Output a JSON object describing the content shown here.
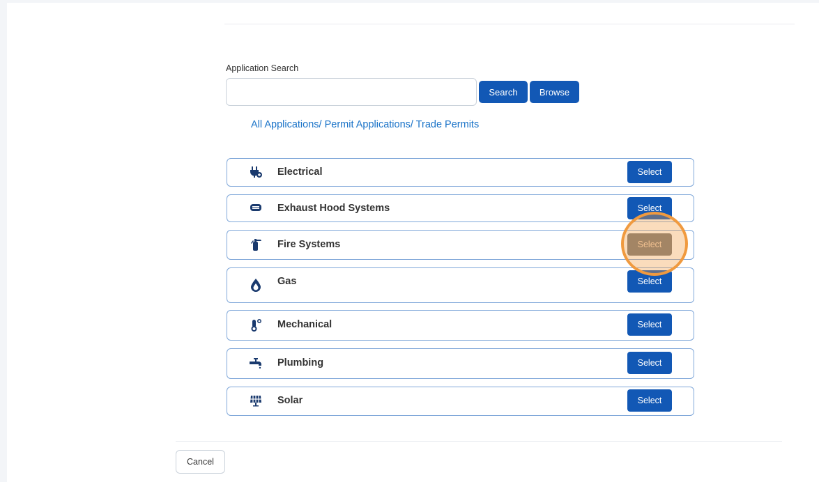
{
  "search": {
    "label": "Application Search",
    "value": "",
    "placeholder": "",
    "search_button": "Search",
    "browse_button": "Browse"
  },
  "breadcrumb": "All Applications/ Permit Applications/ Trade Permits",
  "categories": [
    {
      "label": "Electrical",
      "icon": "plug-icon",
      "button": "Select"
    },
    {
      "label": "Exhaust Hood Systems",
      "icon": "hood-vent-icon",
      "button": "Select"
    },
    {
      "label": "Fire Systems",
      "icon": "fire-extinguisher-icon",
      "button": "Select"
    },
    {
      "label": "Gas",
      "icon": "flame-drop-icon",
      "button": "Select"
    },
    {
      "label": "Mechanical",
      "icon": "thermometer-icon",
      "button": "Select"
    },
    {
      "label": "Plumbing",
      "icon": "faucet-icon",
      "button": "Select"
    },
    {
      "label": "Solar",
      "icon": "solar-panel-icon",
      "button": "Select"
    }
  ],
  "footer": {
    "cancel_button": "Cancel"
  },
  "colors": {
    "primary": "#1258b5",
    "link": "#1a73c8",
    "highlight": "#f09a3f",
    "icon": "#1a3a6e"
  }
}
